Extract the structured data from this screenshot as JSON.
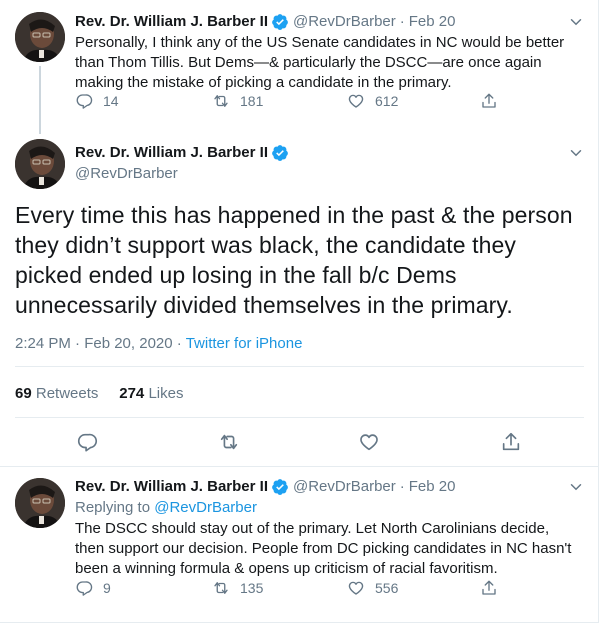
{
  "colors": {
    "text": "#14171a",
    "muted": "#657786",
    "link": "#1b95e0",
    "border": "#e6ecf0"
  },
  "tweet1": {
    "name": "Rev. Dr. William J. Barber II",
    "handle": "@RevDrBarber",
    "time": "Feb 20",
    "text": "Personally, I think any of the US Senate candidates in NC would be better than Thom Tillis. But Dems—& particularly the DSCC—are once again making the mistake of picking a candidate in the primary.",
    "replies": "14",
    "retweets": "181",
    "likes": "612"
  },
  "focused": {
    "name": "Rev. Dr. William J. Barber II",
    "handle": "@RevDrBarber",
    "text": "Every time this has happened in the past & the person they didn’t support was black, the candidate they picked ended up losing in the fall b/c Dems unnecessarily divided themselves in the primary.",
    "timestamp": "2:24 PM · Feb 20, 2020",
    "dot": "·",
    "app": "Twitter for iPhone",
    "retweet_count": "69",
    "retweet_label": "Retweets",
    "like_count": "274",
    "like_label": "Likes"
  },
  "tweet3": {
    "name": "Rev. Dr. William J. Barber II",
    "handle": "@RevDrBarber",
    "time": "Feb 20",
    "replying_label": "Replying to",
    "replying_to": "@RevDrBarber",
    "text": "The DSCC should stay out of the primary. Let North Carolinians decide, then support our decision. People from DC picking candidates in NC hasn't been a winning formula & opens up criticism of racial favoritism.",
    "replies": "9",
    "retweets": "135",
    "likes": "556"
  },
  "icons": [
    "verified-icon",
    "chevron-down-icon",
    "reply-icon",
    "retweet-icon",
    "like-icon",
    "share-icon"
  ]
}
